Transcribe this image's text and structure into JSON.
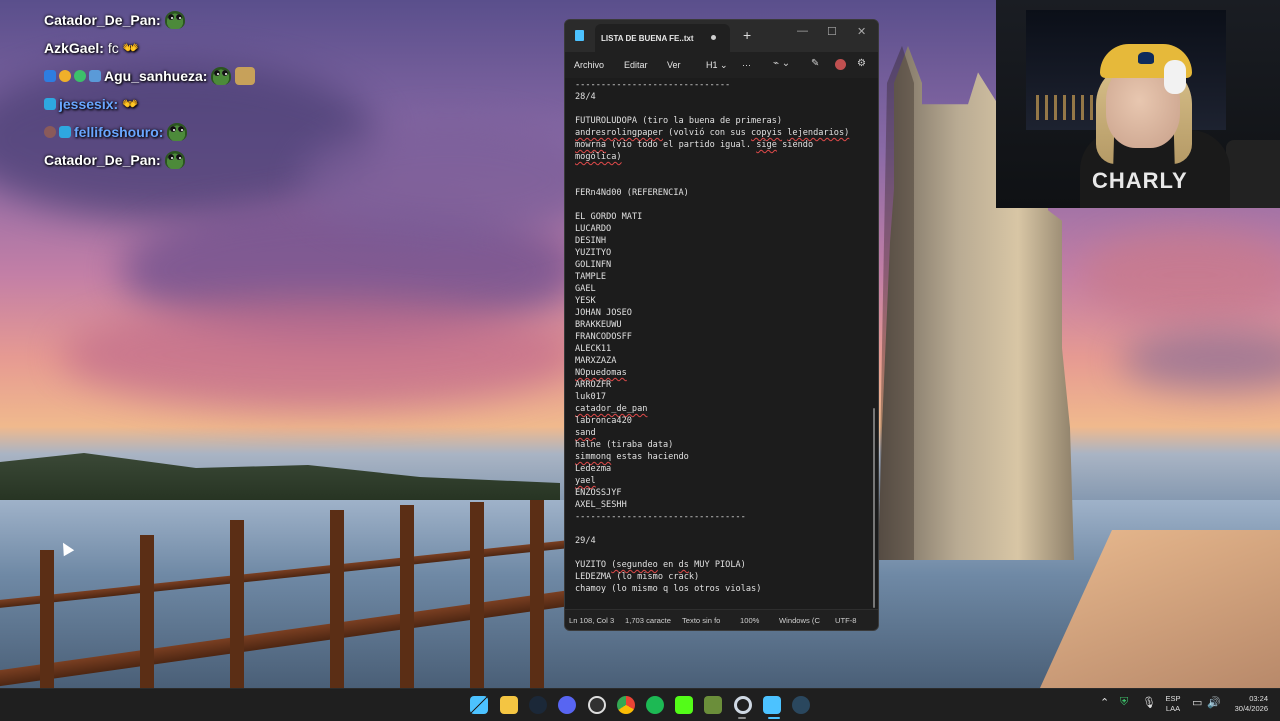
{
  "chat": [
    {
      "user": "Catador_De_Pan:",
      "msg": ""
    },
    {
      "user": "AzkGael:",
      "msg": "fc"
    },
    {
      "user": "Agu_sanhueza:",
      "msg": ""
    },
    {
      "user": "jessesix:",
      "msg": ""
    },
    {
      "user": "fellifoshouro:",
      "msg": ""
    },
    {
      "user": "Catador_De_Pan:",
      "msg": ""
    }
  ],
  "notepad": {
    "tab_title": "LISTA DE BUENA FE..txt",
    "menu": {
      "file": "Archivo",
      "edit": "Editar",
      "view": "Ver",
      "heading": "H1",
      "more": "···"
    },
    "lines": [
      "------------------------------",
      "28/4",
      "",
      "FUTUROLUDOPA (tiro la buena de primeras)",
      "andresrolingpaper (volvió con sus copyis lejendarios)",
      "mowrna (vio todo el partido igual. sige siendo",
      "mogólica)",
      "",
      "",
      "FERn4Nd00 (REFERENCIA)",
      "",
      "EL GORDO MATI",
      "LUCARDO",
      "DESINH",
      "YUZITYO",
      "GOLINFN",
      "TAMPLE",
      "GAEL",
      "YESK",
      "JOHAN JOSEO",
      "BRAKKEUWU",
      "FRANCODOSFF",
      "ALECK11",
      "MARXZAZA",
      "NOpuedomas",
      "ARROZFR",
      "luk017",
      "catador_de_pan",
      "labronca420",
      "sand",
      "halne (tiraba data)",
      "simmonq estas haciendo",
      "Ledezma",
      "yael",
      "ENZOSSJYF",
      "AXEL_SESHH",
      "---------------------------------",
      "",
      "29/4",
      "",
      "YUZITO (segundeo en ds MUY PIOLA)",
      "LEDEZMA (lo mismo crack)",
      "chamoy (lo mismo q los otros violas)"
    ],
    "status": {
      "position": "Ln 108, Col 3",
      "chars": "1,703 caracte",
      "format": "Texto sin fo",
      "zoom": "100%",
      "eol": "Windows (C",
      "encoding": "UTF-8"
    }
  },
  "webcam": {
    "shirt_text": "CHARLY"
  },
  "taskbar": {
    "apps": [
      "windows-start-icon",
      "file-explorer-icon",
      "steam-icon",
      "discord-icon",
      "obs-icon",
      "chrome-icon",
      "spotify-icon",
      "kick-icon",
      "minecraft-icon",
      "cursor-app-icon",
      "notepad-icon",
      "steam-2-icon"
    ],
    "lang_line1": "ESP",
    "lang_line2": "LAA",
    "time": "03:24",
    "date": "30/4/2026"
  },
  "colors": {
    "notepad_bg": "#1c1c1c",
    "spell_error": "#e04a4a",
    "taskbar_bg": "#1f1f1f"
  }
}
